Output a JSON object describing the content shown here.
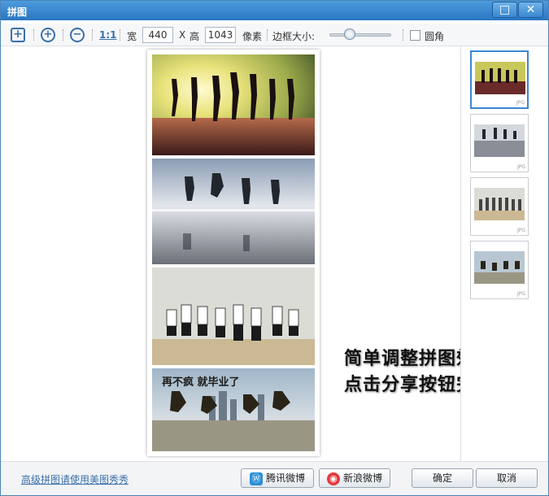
{
  "window": {
    "title": "拼图"
  },
  "toolbar": {
    "ratio_label": "1:1",
    "width_label": "宽",
    "width_value": "440",
    "x_label": "X",
    "height_label": "高",
    "height_value": "1043",
    "unit_label": "像素",
    "border_label": "边框大小:",
    "border_slider_value": 0.25,
    "rounded_label": "圆角",
    "rounded_checked": false
  },
  "thumbnails": [
    {
      "tag": "JPG",
      "selected": true
    },
    {
      "tag": "JPG",
      "selected": false
    },
    {
      "tag": "JPG",
      "selected": false
    },
    {
      "tag": "JPG",
      "selected": false
    }
  ],
  "photo4_caption": "再不疯 就毕业了",
  "overlay": {
    "line1": "简单调整拼图效果",
    "line2": "点击分享按钮完成"
  },
  "footer": {
    "advanced_link": "高级拼图请使用美图秀秀",
    "tencent_label": "腾讯微博",
    "sina_label": "新浪微博",
    "ok_label": "确定",
    "cancel_label": "取消"
  },
  "colors": {
    "titlebar": "#3a86d0",
    "accent": "#3a6fa8"
  }
}
